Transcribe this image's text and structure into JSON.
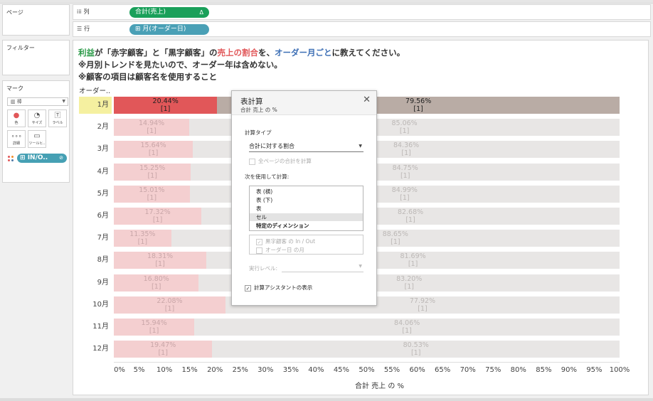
{
  "panes": {
    "pages_title": "ページ",
    "filters_title": "フィルター",
    "marks_title": "マーク",
    "mark_type": "棒",
    "mark_buttons": [
      {
        "label": "色",
        "icon": "color-icon"
      },
      {
        "label": "サイズ",
        "icon": "size-icon"
      },
      {
        "label": "ラベル",
        "icon": "label-icon"
      },
      {
        "label": "詳細",
        "icon": "detail-icon"
      },
      {
        "label": "ツールヒ..",
        "icon": "tooltip-icon"
      }
    ],
    "color_pill": "IN/O.."
  },
  "shelves": {
    "columns_label": "列",
    "columns_pill": "合計(売上)",
    "columns_pill_marker": "Δ",
    "rows_label": "行",
    "rows_pill": "⊞ 月(オーダー日)"
  },
  "view": {
    "title_line1_parts": [
      "利益",
      "が「",
      "赤字顧客",
      "」と「",
      "黒字顧客",
      "」の",
      "売上の割合",
      "を、",
      "オーダー月",
      "ごと",
      "に教えてください。"
    ],
    "title_line2": "※月別トレンドを見たいので、オーダー年は含めない。",
    "title_line3": "※顧客の項目は顧客名を使用すること",
    "row_header_title": "オーダー..",
    "x_axis_title": "合計 売上 の %",
    "x_ticks": [
      "0%",
      "5%",
      "10%",
      "15%",
      "20%",
      "25%",
      "30%",
      "35%",
      "40%",
      "45%",
      "50%",
      "55%",
      "60%",
      "65%",
      "70%",
      "75%",
      "80%",
      "85%",
      "90%",
      "95%",
      "100%"
    ]
  },
  "colors": {
    "loss_highlight": "#e15759",
    "profit_highlight": "#b9aca5",
    "loss_dim": "#f4cfd0",
    "profit_dim": "#e8e6e5",
    "month_highlight_bg": "#f5f0a0"
  },
  "chart_data": {
    "type": "bar",
    "orientation": "horizontal-stacked-100",
    "categories": [
      "1月",
      "2月",
      "3月",
      "4月",
      "5月",
      "6月",
      "7月",
      "8月",
      "9月",
      "10月",
      "11月",
      "12月"
    ],
    "series": [
      {
        "values": [
          20.44,
          14.94,
          15.64,
          15.25,
          15.01,
          17.32,
          11.35,
          18.31,
          16.8,
          22.08,
          15.94,
          19.47
        ],
        "labels": [
          "20.44%",
          "14.94%",
          "15.64%",
          "15.25%",
          "15.01%",
          "17.32%",
          "11.35%",
          "18.31%",
          "16.80%",
          "22.08%",
          "15.94%",
          "19.47%"
        ]
      },
      {
        "values": [
          79.56,
          85.06,
          84.36,
          84.75,
          84.99,
          82.68,
          88.65,
          81.69,
          83.2,
          77.92,
          84.06,
          80.53
        ],
        "labels": [
          "79.56%",
          "85.06%",
          "84.36%",
          "84.75%",
          "84.99%",
          "82.68%",
          "88.65%",
          "81.69%",
          "83.20%",
          "77.92%",
          "84.06%",
          "80.53%"
        ]
      }
    ],
    "secondary_label": "[1]",
    "highlighted_category": "1月",
    "xlim": [
      0,
      100
    ],
    "xlabel": "合計 売上 の %"
  },
  "dialog": {
    "title": "表計算",
    "subtitle": "合計 売上 の %",
    "calc_type_label": "計算タイプ",
    "calc_type_value": "合計に対する割合",
    "all_pages_label": "全ページの合計を計算",
    "compute_using_label": "次を使用して計算:",
    "compute_options": [
      {
        "label": "表 (横)",
        "selected": false,
        "bold": false
      },
      {
        "label": "表 (下)",
        "selected": false,
        "bold": false
      },
      {
        "label": "表",
        "selected": false,
        "bold": false
      },
      {
        "label": "セル",
        "selected": true,
        "bold": false
      },
      {
        "label": "特定のディメンション",
        "selected": false,
        "bold": true
      }
    ],
    "dimensions": [
      {
        "label": "黒字顧客 の In / Out",
        "checked": true
      },
      {
        "label": "オーダー日 の月",
        "checked": false
      }
    ],
    "level_label": "実行レベル:",
    "assistant_label": "計算アシスタントの表示",
    "assistant_checked": true
  }
}
